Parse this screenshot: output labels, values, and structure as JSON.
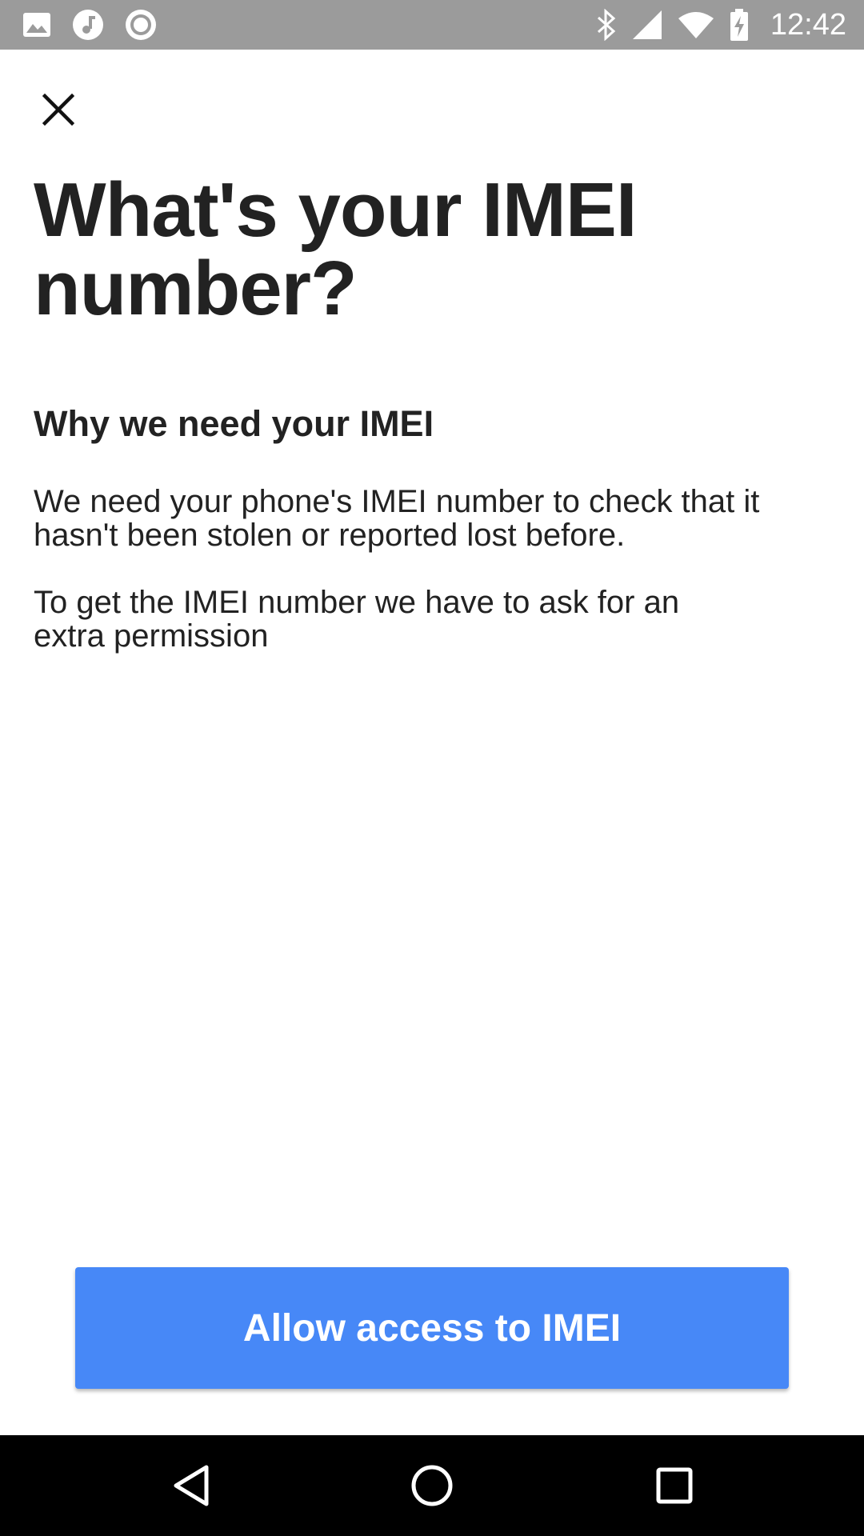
{
  "status_bar": {
    "time": "12:42",
    "left_icons": [
      "image-icon",
      "music-icon",
      "record-icon"
    ],
    "right_icons": [
      "bluetooth-icon",
      "cell-signal-icon",
      "wifi-icon",
      "battery-charging-icon"
    ],
    "background_color": "#9b9b9b"
  },
  "header": {
    "close_icon": "close-icon"
  },
  "content": {
    "title": "What's your IMEI number?",
    "section_heading": "Why we need your IMEI",
    "paragraph_1": "We need your phone's IMEI number to check that it hasn't been stolen or reported lost before.",
    "paragraph_2": "To get the IMEI number we have to ask for an extra permission"
  },
  "actions": {
    "allow_label": "Allow access to IMEI",
    "accent_color": "#4788f7"
  },
  "nav_bar": {
    "icons": [
      "back-icon",
      "home-icon",
      "recents-icon"
    ]
  }
}
